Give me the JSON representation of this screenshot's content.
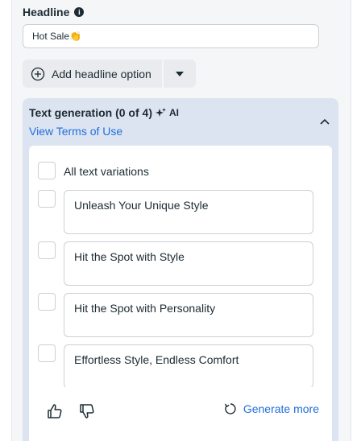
{
  "headline": {
    "label": "Headline",
    "value": "Hot Sale👏"
  },
  "add_option": {
    "label": "Add headline option"
  },
  "generation": {
    "title": "Text generation (0 of 4)",
    "ai_label": "AI",
    "terms_link": "View Terms of Use",
    "all_label": "All text variations",
    "variations": [
      "Unleash Your Unique Style",
      "Hit the Spot with Style",
      "Hit the Spot with Personality",
      "Effortless Style, Endless Comfort"
    ],
    "generate_more": "Generate more"
  },
  "colors": {
    "link": "#216fdb",
    "generation_bg": "#dde4f1"
  }
}
